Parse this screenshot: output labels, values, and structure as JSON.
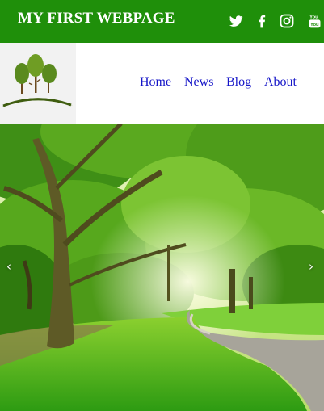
{
  "header": {
    "title": "MY FIRST WEBPAGE",
    "social": [
      {
        "icon": "twitter-icon"
      },
      {
        "icon": "facebook-icon"
      },
      {
        "icon": "instagram-icon"
      },
      {
        "icon": "youtube-icon"
      }
    ]
  },
  "logo": {
    "icon": "trees-logo-icon"
  },
  "nav": {
    "items": [
      {
        "label": "Home"
      },
      {
        "label": "News"
      },
      {
        "label": "Blog"
      },
      {
        "label": "About"
      }
    ]
  },
  "carousel": {
    "prev_glyph": "‹",
    "next_glyph": "›",
    "image": "park-trees-path-photo"
  },
  "colors": {
    "header_bg": "#1f8f0a",
    "nav_link": "#1515c8",
    "header_text": "#ffffff"
  }
}
